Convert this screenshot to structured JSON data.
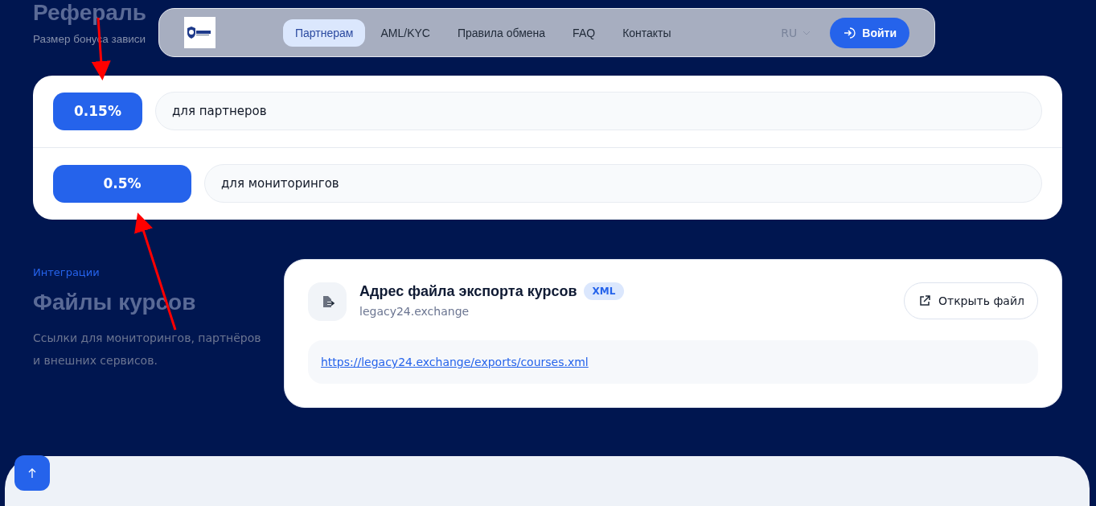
{
  "nav": {
    "items": [
      {
        "label": "Партнерам",
        "selected": true
      },
      {
        "label": "AML/KYC",
        "selected": false
      },
      {
        "label": "Правила обмена",
        "selected": false
      },
      {
        "label": "FAQ",
        "selected": false
      },
      {
        "label": "Контакты",
        "selected": false
      }
    ],
    "language": "RU",
    "login": "Войти"
  },
  "referral": {
    "heading": "Рефераль",
    "subtitle": "Размер бонуса зависи",
    "rates": [
      {
        "value": "0.15%",
        "label": "для партнеров"
      },
      {
        "value": "0.5%",
        "label": "для мониторингов"
      }
    ]
  },
  "integrations": {
    "eyebrow": "Интеграции",
    "heading": "Файлы курсов",
    "description": "Ссылки для мониторингов, партнёров и внешних сервисов.",
    "file": {
      "title": "Адрес файла экспорта курсов",
      "badge": "XML",
      "domain": "legacy24.exchange",
      "open_button": "Открыть файл",
      "url": "https://legacy24.exchange/exports/courses.xml"
    }
  }
}
